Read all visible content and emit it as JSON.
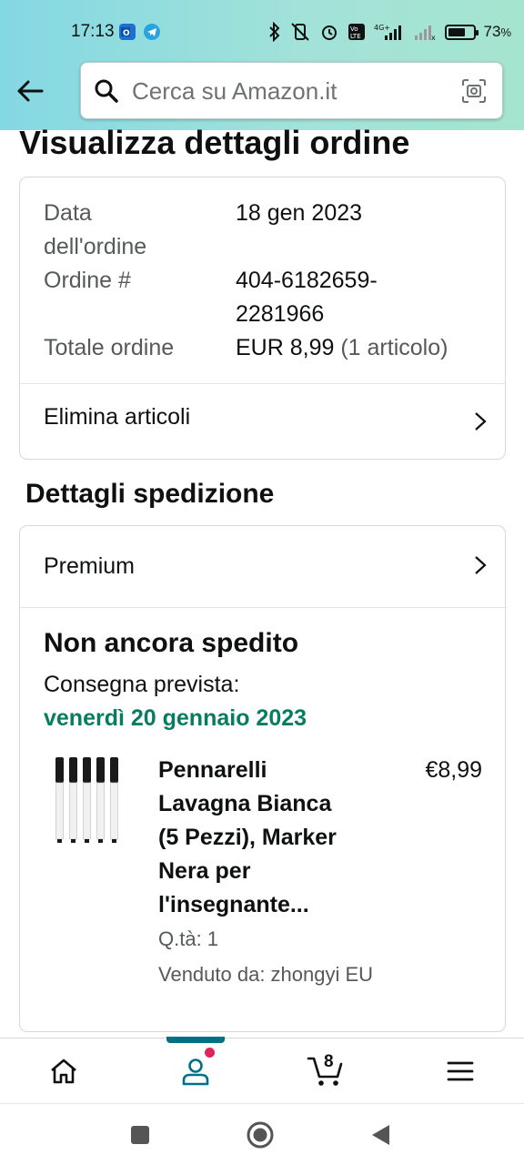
{
  "status_bar": {
    "time": "17:13",
    "battery_percent": "73",
    "battery_level": 0.73
  },
  "search": {
    "placeholder": "Cerca su Amazon.it"
  },
  "page": {
    "title": "Visualizza dettagli ordine"
  },
  "order": {
    "date_label_line1": "Data",
    "date_label_line2": "dell'ordine",
    "date_value": "18 gen 2023",
    "number_label": "Ordine #",
    "number_value_line1": "404-6182659-",
    "number_value_line2": "2281966",
    "total_label": "Totale ordine",
    "total_value": "EUR 8,99",
    "total_items": "(1 articolo)",
    "delete_items_label": "Elimina articoli"
  },
  "shipping": {
    "section_title": "Dettagli spedizione",
    "service_label": "Premium",
    "status": "Non ancora spedito",
    "delivery_label": "Consegna prevista:",
    "delivery_date": "venerdì 20 gennaio 2023",
    "product": {
      "title_lines": [
        "Pennarelli",
        "Lavagna Bianca",
        "(5 Pezzi), Marker",
        "Nera per",
        "l'insegnante..."
      ],
      "price": "€8,99",
      "quantity": "Q.tà: 1",
      "seller": "Venduto da: zhongyi EU",
      "thumbnail": "whiteboard-markers-image"
    }
  },
  "bottom_nav": {
    "items": [
      "home-icon",
      "account-icon",
      "cart-icon",
      "menu-icon"
    ],
    "active": "account",
    "cart_count": "8",
    "accent_color": "#007185",
    "notification_color": "#e0245e"
  },
  "colors": {
    "header_gradient_start": "#84d8e3",
    "header_gradient_end": "#a5e5cf",
    "delivery_green": "#067d62"
  }
}
